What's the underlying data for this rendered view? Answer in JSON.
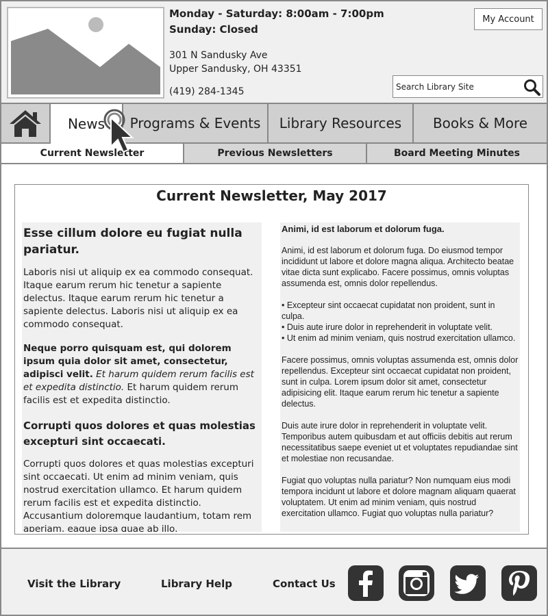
{
  "header": {
    "hours_weekday": "Monday - Saturday: 8:00am - 7:00pm",
    "hours_sunday": "Sunday: Closed",
    "address_line1": "301 N Sandusky Ave",
    "address_line2": "Upper Sandusky, OH 43351",
    "phone": "(419) 284-1345",
    "account_label": "My Account",
    "search_placeholder": "Search Library Site"
  },
  "nav": {
    "news": "News",
    "programs": "Programs & Events",
    "resources": "Library Resources",
    "books": "Books & More",
    "active": "News"
  },
  "subnav": {
    "current": "Current Newsletter",
    "previous": "Previous Newsletters",
    "minutes": "Board Meeting Minutes",
    "active": "Current Newsletter"
  },
  "newsletter": {
    "title": "Current Newsletter, May 2017",
    "left": {
      "heading1": "Esse cillum dolore eu fugiat nulla pariatur.",
      "para1": "Laboris nisi ut aliquip ex ea commodo consequat. Itaque earum rerum hic tenetur a sapiente delectus. Itaque earum rerum hic tenetur a sapiente delectus. Laboris nisi ut aliquip ex ea commodo consequat.",
      "para2_bold": "Neque porro quisquam est, qui dolorem ipsum quia dolor sit amet, consectetur, adipisci velit.",
      "para2_italic": "Et harum quidem rerum facilis est et expedita distinctio.",
      "para2_rest": "Et harum quidem rerum facilis est et expedita distinctio.",
      "heading2": "Corrupti quos dolores et quas molestias excepturi sint occaecati.",
      "para3": "Corrupti quos dolores et quas molestias excepturi sint occaecati. Ut enim ad minim veniam, quis nostrud exercitation ullamco. Et harum quidem rerum facilis est et expedita distinctio. Accusantium doloremque laudantium, totam rem aperiam, eaque ipsa quae ab illo."
    },
    "right": {
      "heading": "Animi, id est laborum et dolorum fuga.",
      "para1": "Animi, id est laborum et dolorum fuga. Do eiusmod tempor incididunt ut labore et dolore magna aliqua. Architecto beatae vitae dicta sunt explicabo. Facere possimus, omnis voluptas assumenda est, omnis dolor repellendus.",
      "bullets": [
        "• Excepteur sint occaecat cupidatat non proident, sunt in culpa.",
        "• Duis aute irure dolor in reprehenderit in voluptate velit.",
        "• Ut enim ad minim veniam, quis nostrud exercitation ullamco."
      ],
      "para2": "Facere possimus, omnis voluptas assumenda est, omnis dolor repellendus. Excepteur sint occaecat cupidatat non proident, sunt in culpa. Lorem ipsum dolor sit amet, consectetur adipisicing elit. Itaque earum rerum hic tenetur a sapiente delectus.",
      "para3": "Duis aute irure dolor in reprehenderit in voluptate velit. Temporibus autem quibusdam et aut officiis debitis aut rerum necessitatibus saepe eveniet ut et voluptates repudiandae sint et molestiae non recusandae.",
      "para4": "Fugiat quo voluptas nulla pariatur? Non numquam eius modi tempora incidunt ut labore et dolore magnam aliquam quaerat voluptatem. Ut enim ad minim veniam, quis nostrud exercitation ullamco. Fugiat quo voluptas nulla pariatur?"
    }
  },
  "footer": {
    "visit": "Visit the Library",
    "help": "Library Help",
    "contact": "Contact Us",
    "social_icons": [
      "facebook-icon",
      "instagram-icon",
      "twitter-icon",
      "pinterest-icon"
    ]
  },
  "colors": {
    "header_bg": "#f0f0f0",
    "nav_bg": "#d0d0d0",
    "border": "#888888",
    "social_icon_bg": "#333333"
  }
}
